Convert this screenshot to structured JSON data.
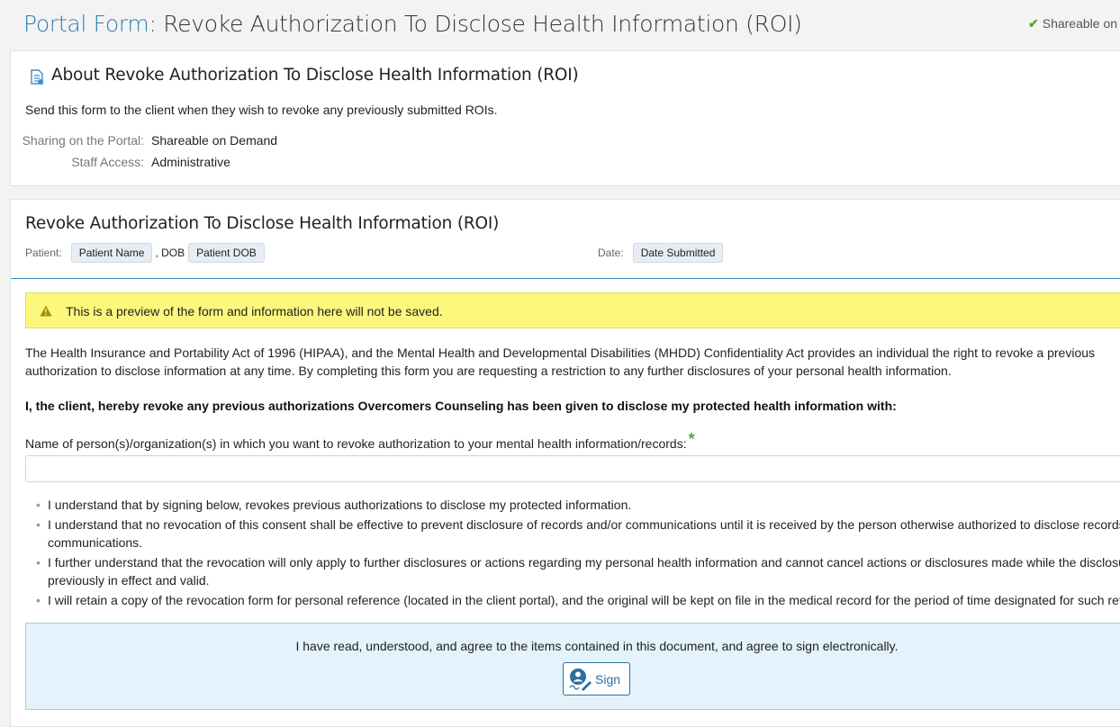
{
  "header": {
    "title_prefix": "Portal Form",
    "title_colon": ": ",
    "title_main": "Revoke Authorization To Disclose Health Information (ROI)",
    "status_label": "Shareable on"
  },
  "about": {
    "heading": "About Revoke Authorization To Disclose Health Information (ROI)",
    "description": "Send this form to the client when they wish to revoke any previously submitted ROIs.",
    "sharing_label": "Sharing on the Portal:",
    "sharing_value": "Shareable on Demand",
    "staff_label": "Staff Access:",
    "staff_value": "Administrative"
  },
  "form": {
    "title": "Revoke Authorization To Disclose Health Information (ROI)",
    "patient_label": "Patient:",
    "patient_name_tag": "Patient Name",
    "dob_sep": ", DOB",
    "patient_dob_tag": "Patient DOB",
    "date_label": "Date:",
    "date_tag": "Date Submitted",
    "alert_text": "This is a preview of the form and information here will not be saved.",
    "intro_paragraph": "The Health Insurance and Portability Act of 1996 (HIPAA), and the Mental Health and Developmental Disabilities (MHDD) Confidentiality Act provides an individual the right to revoke a previous authorization to disclose information at any time. By completing this form you are requesting a restriction to any further disclosures of your personal health information.",
    "statement": "I, the client, hereby revoke any previous authorizations Overcomers Counseling has been given to disclose my protected health information with:",
    "field_label": "Name of person(s)/organization(s) in which you want to revoke authorization to your mental health information/records:",
    "required_mark": "*",
    "field_value": "",
    "bullets": [
      {
        "line1": "I understand that by signing below, revokes previous authorizations to disclose my protected information.",
        "line2": ""
      },
      {
        "line1": "I understand that no revocation of this consent shall be effective to prevent disclosure of records and/or communications until it is received by the person otherwise authorized to disclose records",
        "line2": "communications."
      },
      {
        "line1": "I further understand that the revocation will only apply to further disclosures or actions regarding my personal health information and cannot cancel actions or disclosures made while the disclosu",
        "line2": "previously in effect and valid."
      },
      {
        "line1": "I will retain a copy of the revocation form for personal reference (located in the client portal), and the original will be kept on file in the medical record for the period of time designated for such ret",
        "line2": ""
      }
    ],
    "bullet_glyph": "•",
    "agree_text": "I have read, understood, and agree to the items contained in this document, and agree to sign electronically.",
    "sign_button": "Sign"
  },
  "colors": {
    "link_blue": "#2e7fb0",
    "alert_yellow": "#fbf87d",
    "sign_panel": "#e3f2fb",
    "required_green": "#5aa832"
  },
  "icons": {
    "check": "check-icon",
    "document": "document-icon",
    "warning": "warning-icon",
    "signature": "signature-icon"
  }
}
